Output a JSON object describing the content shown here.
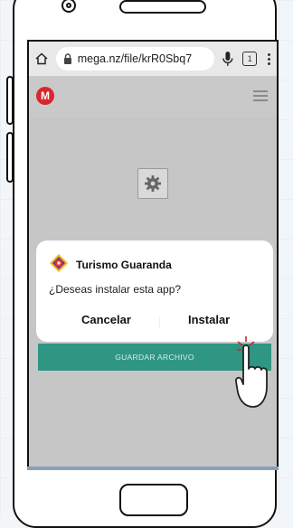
{
  "browser": {
    "url": "mega.nz/file/krR0Sbq7",
    "tab_count": "1"
  },
  "icons": {
    "home": "home-icon",
    "lock": "lock-icon",
    "mic": "microphone-icon",
    "tabs": "tabs-icon",
    "menu": "more-vert-icon",
    "app_menu": "hamburger-icon",
    "settings": "gear-icon",
    "pointer": "hand-pointer-icon"
  },
  "app": {
    "logo_letter": "M",
    "save_button_label": "GUARDAR ARCHIVO"
  },
  "dialog": {
    "app_name": "Turismo Guaranda",
    "message": "¿Deseas instalar esta app?",
    "cancel_label": "Cancelar",
    "install_label": "Instalar"
  },
  "colors": {
    "mega_red": "#d9272e",
    "save_green": "#2f9683",
    "screen_gray": "#c6c6c6"
  }
}
